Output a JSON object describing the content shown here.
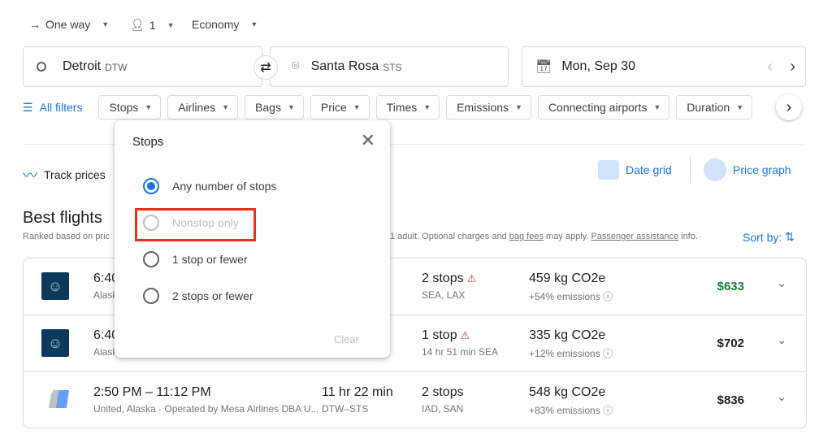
{
  "trip": {
    "type": "One way",
    "passengers": "1",
    "cabin": "Economy"
  },
  "search": {
    "origin": "Detroit",
    "origin_code": "DTW",
    "destination": "Santa Rosa",
    "destination_code": "STS",
    "date": "Mon, Sep 30"
  },
  "filters": {
    "all": "All filters",
    "chips": [
      "Stops",
      "Airlines",
      "Bags",
      "Price",
      "Times",
      "Emissions",
      "Connecting airports",
      "Duration"
    ]
  },
  "track_prices": "Track prices",
  "date_grid": "Date grid",
  "price_graph": "Price graph",
  "results": {
    "title": "Best flights",
    "subtitle_left": "Ranked based on pric",
    "subtitle_right_1": "1 adult. Optional charges and ",
    "bag_fees": "bag fees",
    "subtitle_right_2": " may apply. ",
    "passenger_assistance": "Passenger assistance",
    "subtitle_right_3": " info.",
    "sort_by": "Sort by:"
  },
  "flights": [
    {
      "times": "6:40",
      "airline": "Alask",
      "duration": "",
      "route": "",
      "stops": "2 stops",
      "stops_detail": "SEA, LAX",
      "warning": true,
      "co2": "459 kg CO2e",
      "emissions": "+54% emissions",
      "price": "$633",
      "price_color": "#188038"
    },
    {
      "times": "6:40",
      "airline": "Alask",
      "duration": "",
      "route": "",
      "stops": "1 stop",
      "stops_detail": "14 hr 51 min SEA",
      "warning": true,
      "co2": "335 kg CO2e",
      "emissions": "+12% emissions",
      "price": "$702",
      "price_color": "#202124"
    },
    {
      "times": "2:50 PM – 11:12 PM",
      "airline": "United, Alaska · Operated by Mesa Airlines DBA U...",
      "duration": "11 hr 22 min",
      "route": "DTW–STS",
      "stops": "2 stops",
      "stops_detail": "IAD, SAN",
      "warning": false,
      "co2": "548 kg CO2e",
      "emissions": "+83% emissions",
      "price": "$836",
      "price_color": "#202124"
    }
  ],
  "stops_popup": {
    "title": "Stops",
    "options": [
      "Any number of stops",
      "Nonstop only",
      "1 stop or fewer",
      "2 stops or fewer"
    ],
    "selected": "Any number of stops",
    "disabled": "Nonstop only",
    "clear": "Clear"
  },
  "colors": {
    "accent": "#1a73e8",
    "highlight": "#e8321e",
    "cheapest": "#188038"
  }
}
